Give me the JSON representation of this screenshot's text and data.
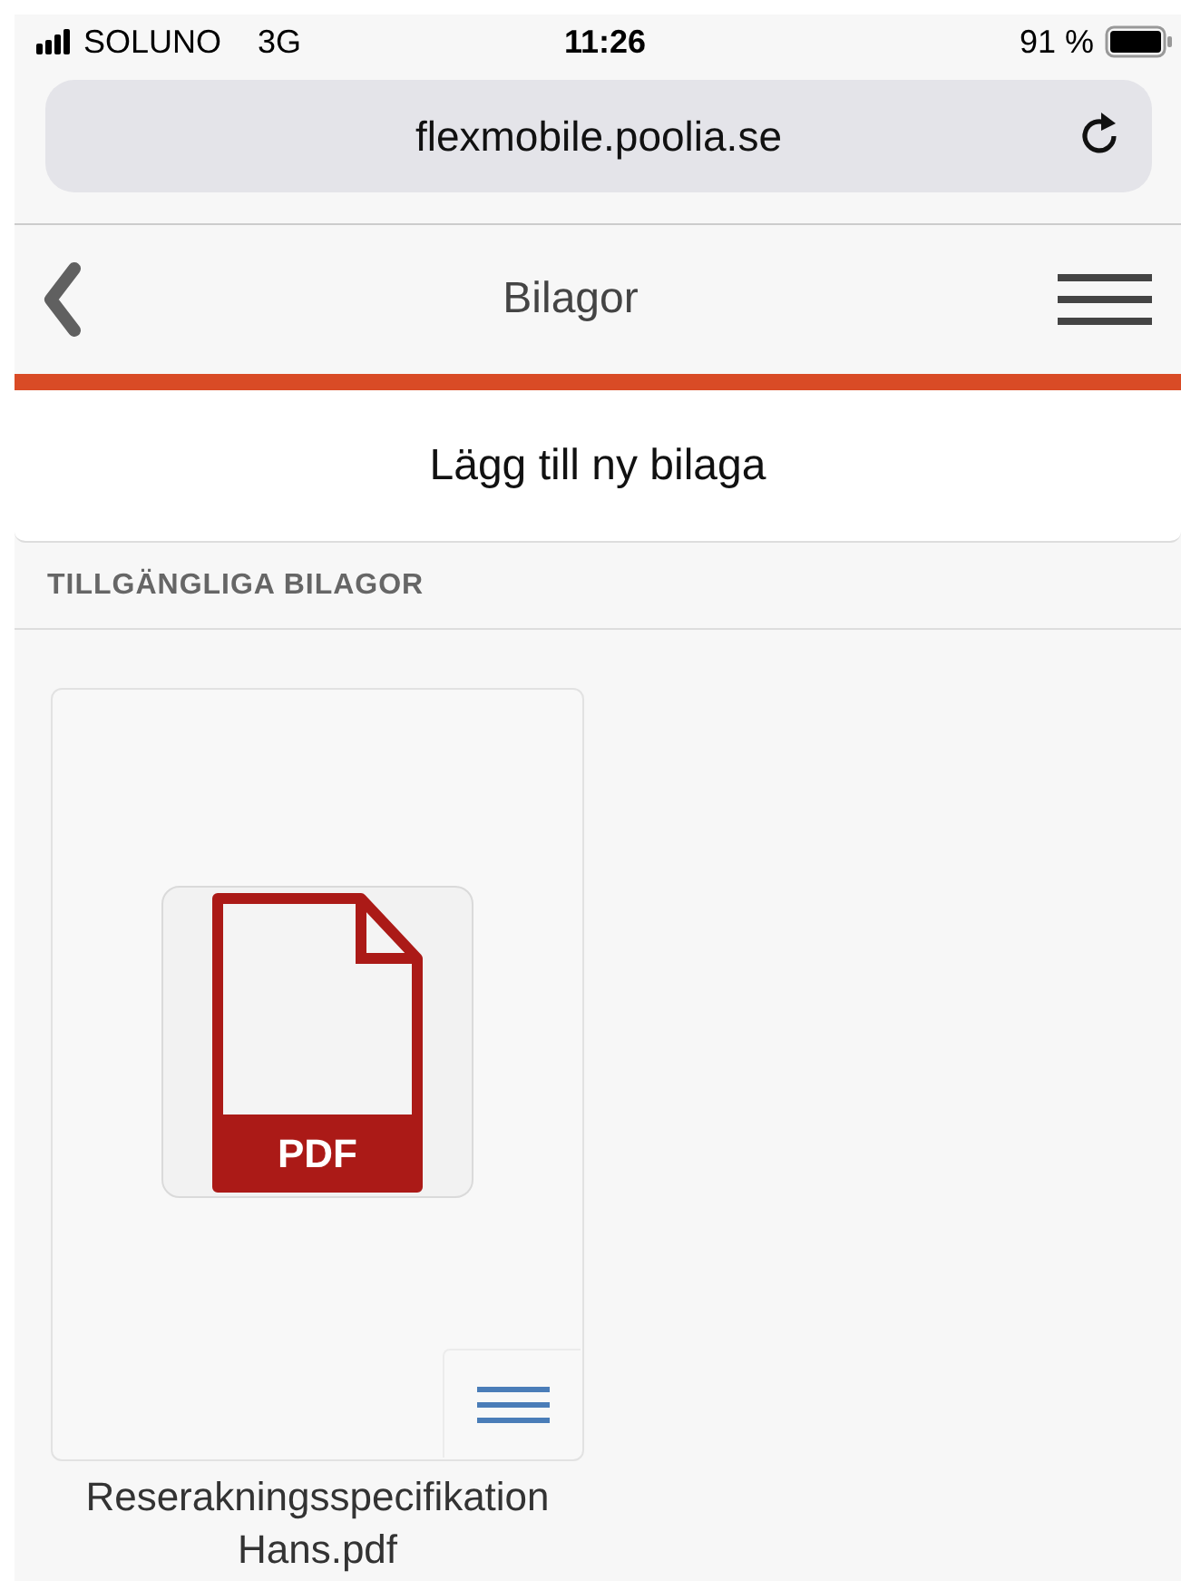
{
  "status_bar": {
    "carrier": "SOLUNO",
    "network": "3G",
    "time": "11:26",
    "battery": "91 %"
  },
  "browser": {
    "url": "flexmobile.poolia.se"
  },
  "header": {
    "title": "Bilagor"
  },
  "add_button": "Lägg till ny bilaga",
  "section_title": "TILLGÄNGLIGA BILAGOR",
  "attachments": [
    {
      "kind": "pdf",
      "badge": "PDF",
      "filename": "Reserakningsspecifikation Hans.pdf"
    }
  ]
}
